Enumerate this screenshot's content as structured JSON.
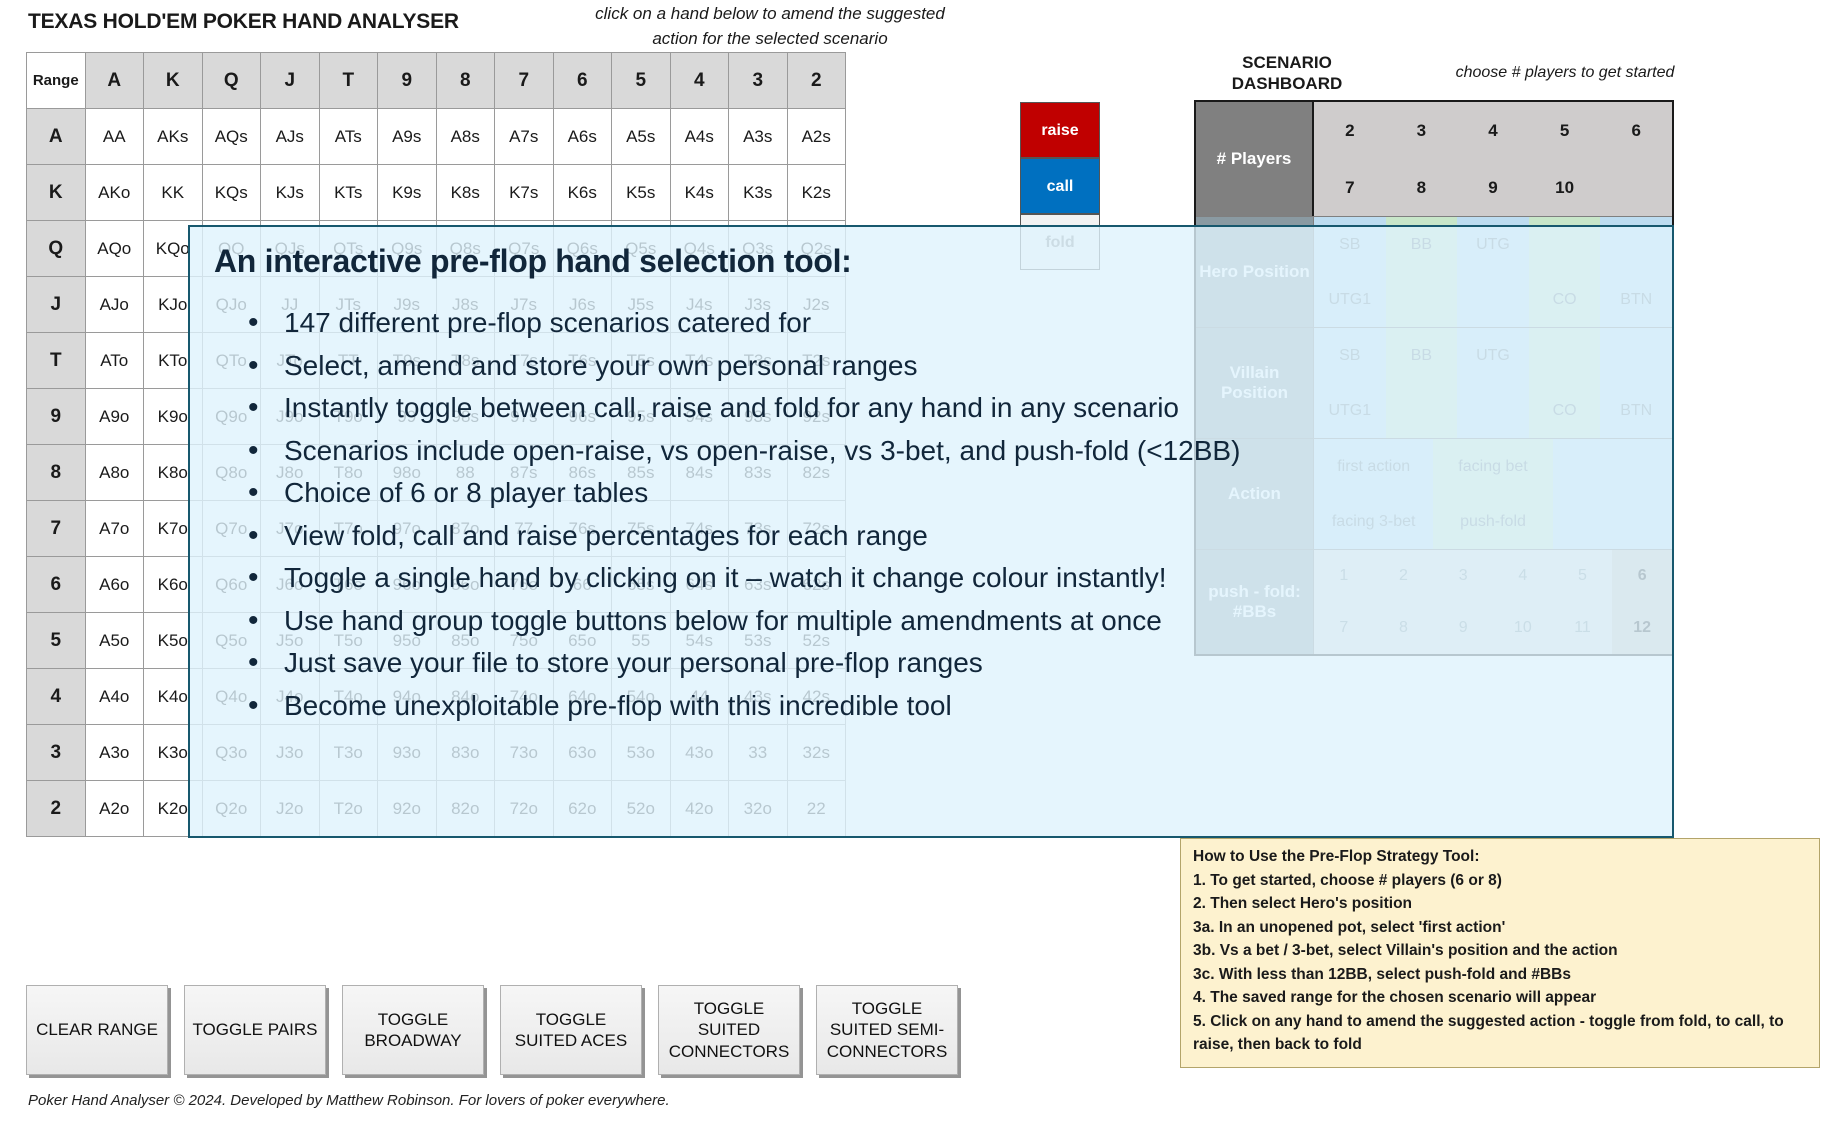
{
  "header": {
    "app_title": "TEXAS HOLD'EM POKER HAND ANALYSER",
    "click_hint": "click on a hand below to amend the suggested action for the selected scenario",
    "dashboard_title": "SCENARIO DASHBOARD",
    "choose_players_hint": "choose # players to get started"
  },
  "matrix": {
    "corner_label": "Range",
    "columns": [
      "A",
      "K",
      "Q",
      "J",
      "T",
      "9",
      "8",
      "7",
      "6",
      "5",
      "4",
      "3",
      "2"
    ],
    "rows": [
      {
        "head": "A",
        "cells": [
          "AA",
          "AKs",
          "AQs",
          "AJs",
          "ATs",
          "A9s",
          "A8s",
          "A7s",
          "A6s",
          "A5s",
          "A4s",
          "A3s",
          "A2s"
        ]
      },
      {
        "head": "K",
        "cells": [
          "AKo",
          "KK",
          "KQs",
          "KJs",
          "KTs",
          "K9s",
          "K8s",
          "K7s",
          "K6s",
          "K5s",
          "K4s",
          "K3s",
          "K2s"
        ]
      },
      {
        "head": "Q",
        "cells": [
          "AQo",
          "KQo",
          "QQ",
          "QJs",
          "QTs",
          "Q9s",
          "Q8s",
          "Q7s",
          "Q6s",
          "Q5s",
          "Q4s",
          "Q3s",
          "Q2s"
        ]
      },
      {
        "head": "J",
        "cells": [
          "AJo",
          "KJo",
          "QJo",
          "JJ",
          "JTs",
          "J9s",
          "J8s",
          "J7s",
          "J6s",
          "J5s",
          "J4s",
          "J3s",
          "J2s"
        ]
      },
      {
        "head": "T",
        "cells": [
          "ATo",
          "KTo",
          "QTo",
          "JTo",
          "TT",
          "T9s",
          "T8s",
          "T7s",
          "T6s",
          "T5s",
          "T4s",
          "T3s",
          "T2s"
        ]
      },
      {
        "head": "9",
        "cells": [
          "A9o",
          "K9o",
          "Q9o",
          "J9o",
          "T9o",
          "99",
          "98s",
          "97s",
          "96s",
          "95s",
          "94s",
          "93s",
          "92s"
        ]
      },
      {
        "head": "8",
        "cells": [
          "A8o",
          "K8o",
          "Q8o",
          "J8o",
          "T8o",
          "98o",
          "88",
          "87s",
          "86s",
          "85s",
          "84s",
          "83s",
          "82s"
        ]
      },
      {
        "head": "7",
        "cells": [
          "A7o",
          "K7o",
          "Q7o",
          "J7o",
          "T7o",
          "97o",
          "87o",
          "77",
          "76s",
          "75s",
          "74s",
          "73s",
          "72s"
        ]
      },
      {
        "head": "6",
        "cells": [
          "A6o",
          "K6o",
          "Q6o",
          "J6o",
          "T6o",
          "96o",
          "86o",
          "76o",
          "66",
          "65s",
          "64s",
          "63s",
          "62s"
        ]
      },
      {
        "head": "5",
        "cells": [
          "A5o",
          "K5o",
          "Q5o",
          "J5o",
          "T5o",
          "95o",
          "85o",
          "75o",
          "65o",
          "55",
          "54s",
          "53s",
          "52s"
        ]
      },
      {
        "head": "4",
        "cells": [
          "A4o",
          "K4o",
          "Q4o",
          "J4o",
          "T4o",
          "94o",
          "84o",
          "74o",
          "64o",
          "54o",
          "44",
          "43s",
          "42s"
        ]
      },
      {
        "head": "3",
        "cells": [
          "A3o",
          "K3o",
          "Q3o",
          "J3o",
          "T3o",
          "93o",
          "83o",
          "73o",
          "63o",
          "53o",
          "43o",
          "33",
          "32s"
        ]
      },
      {
        "head": "2",
        "cells": [
          "A2o",
          "K2o",
          "Q2o",
          "J2o",
          "T2o",
          "92o",
          "82o",
          "72o",
          "62o",
          "52o",
          "42o",
          "32o",
          "22"
        ]
      }
    ]
  },
  "action_legend": {
    "raise": "raise",
    "call": "call",
    "fold": "fold",
    "raise_color": "#c00000",
    "call_color": "#0070c0",
    "fold_color": "#f2f2f2"
  },
  "dashboard": {
    "players": {
      "label": "# Players",
      "options": [
        "2",
        "3",
        "4",
        "5",
        "6",
        "7",
        "8",
        "9",
        "10",
        ""
      ]
    },
    "hero_position": {
      "label": "Hero Position",
      "options": [
        "SB",
        "BB",
        "UTG",
        "",
        "",
        "UTG1",
        "",
        "",
        "CO",
        "BTN"
      ]
    },
    "villain_position": {
      "label": "Villain Position",
      "options": [
        "SB",
        "BB",
        "UTG",
        "",
        "",
        "UTG1",
        "",
        "",
        "CO",
        "BTN"
      ]
    },
    "action": {
      "label": "Action",
      "options": [
        "first action",
        "facing bet",
        "",
        "facing 3-bet",
        "push-fold",
        ""
      ]
    },
    "push_fold": {
      "label": "push - fold: #BBs",
      "options": [
        "1",
        "2",
        "3",
        "4",
        "5",
        "6",
        "7",
        "8",
        "9",
        "10",
        "11",
        "12"
      ],
      "selected": [
        "6",
        "12"
      ]
    }
  },
  "overlay": {
    "heading": "An interactive pre-flop hand selection tool:",
    "bullets": [
      "147 different pre-flop scenarios catered for",
      "Select, amend and store your own personal ranges",
      "Instantly toggle between call, raise and fold for any hand in any scenario",
      "Scenarios include open-raise, vs open-raise, vs 3-bet, and push-fold (<12BB)",
      "Choice of 6 or 8 player tables",
      "View fold, call and raise percentages for each range",
      "Toggle a single hand by clicking on it – watch it change colour instantly!",
      "Use hand group toggle buttons below for multiple amendments at once",
      "Just save your file to store your personal pre-flop ranges",
      "Become unexploitable pre-flop with this incredible tool"
    ]
  },
  "howto": {
    "title": "How to Use the Pre-Flop Strategy Tool:",
    "steps": [
      "1. To get started, choose # players (6 or 8)",
      "2. Then select Hero's position",
      "3a. In an unopened pot, select 'first action'",
      "3b. Vs a bet / 3-bet, select Villain's position and the action",
      "3c. With less than 12BB, select push-fold and #BBs",
      "4. The saved range for the chosen scenario will appear",
      "5. Click on any hand to amend the suggested action - toggle from fold, to call, to raise, then back to fold"
    ]
  },
  "toggle_buttons": [
    "CLEAR RANGE",
    "TOGGLE PAIRS",
    "TOGGLE BROADWAY",
    "TOGGLE SUITED ACES",
    "TOGGLE SUITED CONNECTORS",
    "TOGGLE SUITED SEMI-CONNECTORS"
  ],
  "footer": {
    "credit": "Poker Hand Analyser © 2024. Developed by Matthew Robinson. For lovers of poker everywhere."
  }
}
